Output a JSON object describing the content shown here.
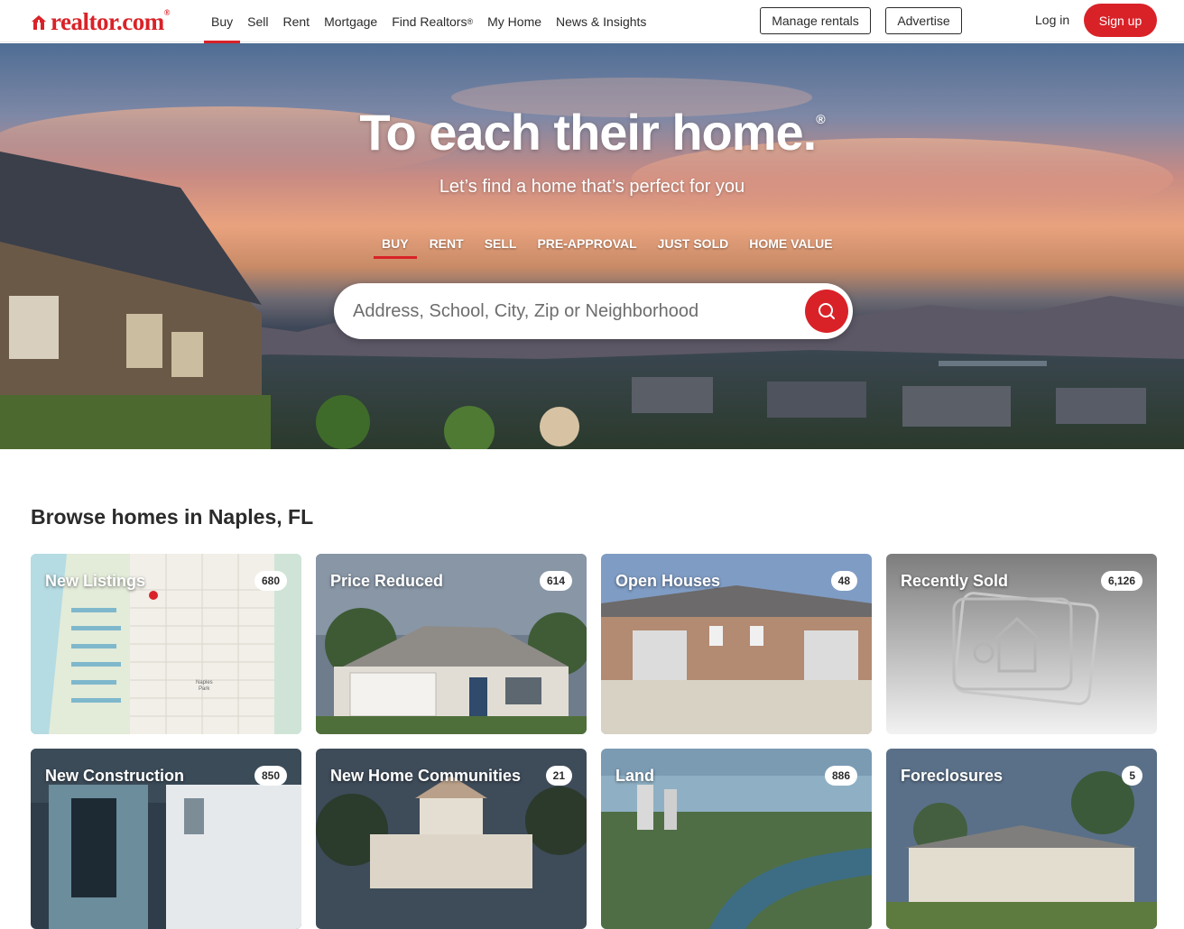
{
  "header": {
    "logo_text": "realtor.com",
    "logo_tm": "®",
    "nav": [
      {
        "label": "Buy"
      },
      {
        "label": "Sell"
      },
      {
        "label": "Rent"
      },
      {
        "label": "Mortgage"
      },
      {
        "label": "Find Realtors"
      },
      {
        "label": "My Home"
      },
      {
        "label": "News & Insights"
      }
    ],
    "find_realtors_sup": "®",
    "manage_rentals": "Manage rentals",
    "advertise": "Advertise",
    "login": "Log in",
    "signup": "Sign up"
  },
  "hero": {
    "title": "To each their home.",
    "title_reg": "®",
    "subtitle": "Let’s find a home that’s perfect for you",
    "tabs": [
      {
        "label": "BUY"
      },
      {
        "label": "RENT"
      },
      {
        "label": "SELL"
      },
      {
        "label": "PRE-APPROVAL"
      },
      {
        "label": "JUST SOLD"
      },
      {
        "label": "HOME VALUE"
      }
    ],
    "search_placeholder": "Address, School, City, Zip or Neighborhood"
  },
  "browse": {
    "title": "Browse homes in Naples, FL",
    "cards": [
      {
        "label": "New Listings",
        "count": "680"
      },
      {
        "label": "Price Reduced",
        "count": "614"
      },
      {
        "label": "Open Houses",
        "count": "48"
      },
      {
        "label": "Recently Sold",
        "count": "6,126"
      },
      {
        "label": "New Construction",
        "count": "850"
      },
      {
        "label": "New Home Communities",
        "count": "21"
      },
      {
        "label": "Land",
        "count": "886"
      },
      {
        "label": "Foreclosures",
        "count": "5"
      }
    ],
    "map_labels": [
      "Naples",
      "Park"
    ]
  },
  "colors": {
    "brand_red": "#d92228",
    "text_dark": "#2b2b2b"
  }
}
